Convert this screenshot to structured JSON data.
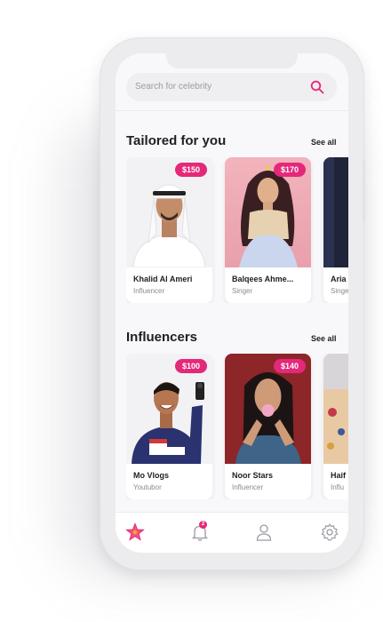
{
  "search": {
    "placeholder": "Search for celebrity"
  },
  "sections": [
    {
      "title": "Tailored for you",
      "see_all": "See all",
      "cards": [
        {
          "name": "Khalid Al Ameri",
          "role": "Influencer",
          "price": "$150"
        },
        {
          "name": "Balqees Ahme...",
          "role": "Singer",
          "price": "$170"
        },
        {
          "name": "Aria",
          "role": "Singe",
          "price": ""
        }
      ]
    },
    {
      "title": "Influencers",
      "see_all": "See all",
      "cards": [
        {
          "name": "Mo Vlogs",
          "role": "Youtubor",
          "price": "$100"
        },
        {
          "name": "Noor Stars",
          "role": "Influencer",
          "price": "$140"
        },
        {
          "name": "Haif",
          "role": "Influ",
          "price": ""
        }
      ]
    }
  ],
  "tabbar": {
    "notification_count": "2"
  },
  "colors": {
    "accent": "#e4287a",
    "star": "#f0567a"
  }
}
